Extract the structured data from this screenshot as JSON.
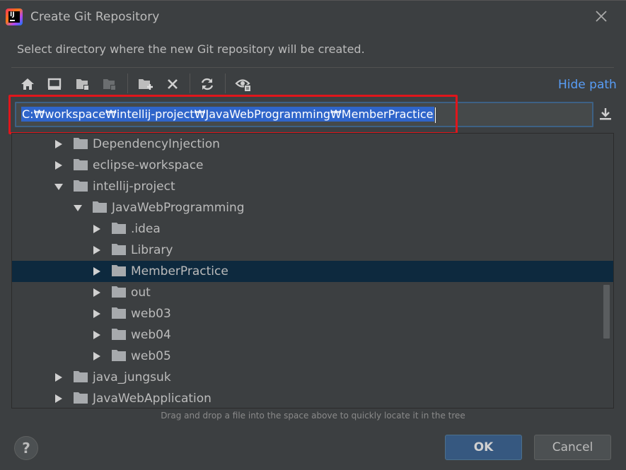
{
  "window": {
    "title": "Create Git Repository",
    "subtitle": "Select directory where the new Git repository will be created."
  },
  "toolbar": {
    "buttons": [
      "home-icon",
      "desktop-icon",
      "new-folder-project-icon",
      "new-folder-module-icon",
      "new-folder-icon",
      "delete-icon",
      "refresh-icon",
      "show-hidden-icon"
    ],
    "hide_path_label": "Hide path"
  },
  "path": {
    "value": "C:₩workspace₩intellij-project₩JavaWebProgramming₩MemberPractice"
  },
  "tree": {
    "rows": [
      {
        "label": "DependencyInjection",
        "expanded": false
      },
      {
        "label": "eclipse-workspace",
        "expanded": false
      },
      {
        "label": "intellij-project",
        "expanded": true
      },
      {
        "label": "JavaWebProgramming",
        "expanded": true
      },
      {
        "label": ".idea",
        "expanded": false
      },
      {
        "label": "Library",
        "expanded": false
      },
      {
        "label": "MemberPractice",
        "expanded": false,
        "selected": true
      },
      {
        "label": "out",
        "expanded": false
      },
      {
        "label": "web03",
        "expanded": false
      },
      {
        "label": "web04",
        "expanded": false
      },
      {
        "label": "web05",
        "expanded": false
      },
      {
        "label": "java_jungsuk",
        "expanded": false
      },
      {
        "label": "JavaWebApplication",
        "expanded": false
      }
    ]
  },
  "hint": "Drag and drop a file into the space above to quickly locate it in the tree",
  "footer": {
    "help_label": "?",
    "ok_label": "OK",
    "cancel_label": "Cancel"
  },
  "colors": {
    "background": "#3c3f41",
    "selection": "#0d293e",
    "accent_link": "#589df6",
    "ok_button": "#365880",
    "highlight_box": "#e0161c"
  }
}
